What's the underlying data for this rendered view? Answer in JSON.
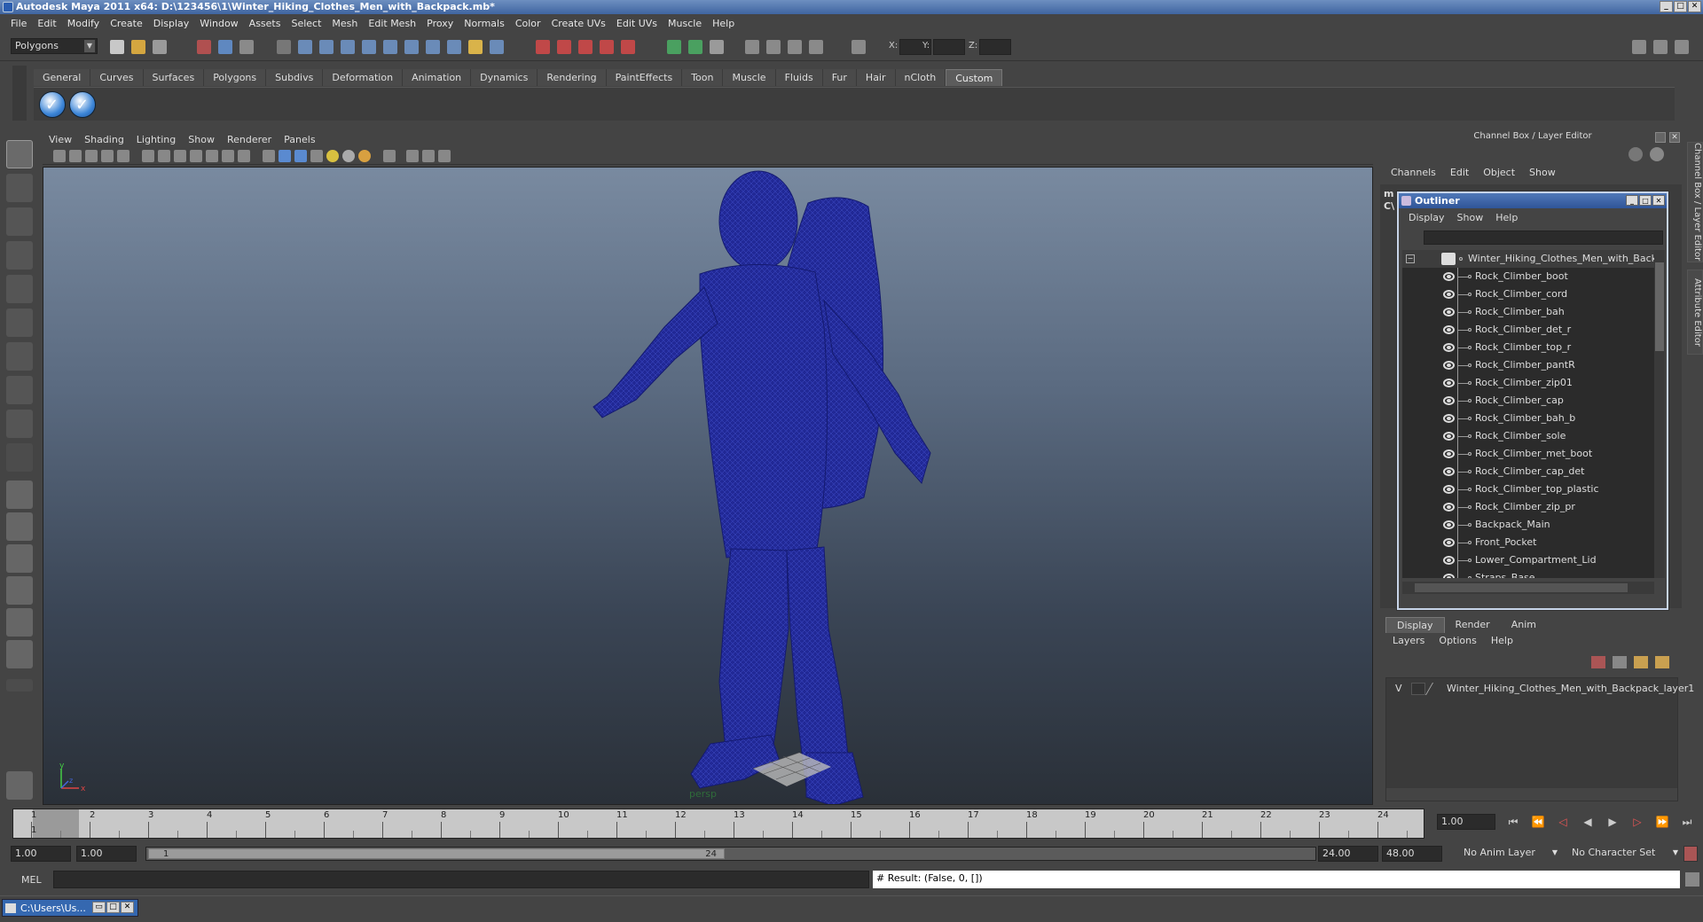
{
  "window": {
    "title": "Autodesk Maya 2011 x64: D:\\123456\\1\\Winter_Hiking_Clothes_Men_with_Backpack.mb*"
  },
  "menubar": [
    "File",
    "Edit",
    "Modify",
    "Create",
    "Display",
    "Window",
    "Assets",
    "Select",
    "Mesh",
    "Edit Mesh",
    "Proxy",
    "Normals",
    "Color",
    "Create UVs",
    "Edit UVs",
    "Muscle",
    "Help"
  ],
  "status": {
    "mode_select": "Polygons",
    "x_label": "X:",
    "y_label": "Y:",
    "z_label": "Z:"
  },
  "shelf": {
    "tabs": [
      "General",
      "Curves",
      "Surfaces",
      "Polygons",
      "Subdivs",
      "Deformation",
      "Animation",
      "Dynamics",
      "Rendering",
      "PaintEffects",
      "Toon",
      "Muscle",
      "Fluids",
      "Fur",
      "Hair",
      "nCloth",
      "Custom"
    ],
    "active": "Custom"
  },
  "viewport": {
    "menu": [
      "View",
      "Shading",
      "Lighting",
      "Show",
      "Renderer",
      "Panels"
    ],
    "camera_label": "persp",
    "axis_x": "x",
    "axis_y": "y",
    "axis_z": "z"
  },
  "channel_box": {
    "header": "Channel Box / Layer Editor",
    "menu": [
      "Channels",
      "Edit",
      "Object",
      "Show"
    ],
    "partial_label_1": "m",
    "partial_label_2": "C\\"
  },
  "outliner": {
    "title": "Outliner",
    "menu": [
      "Display",
      "Show",
      "Help"
    ],
    "root": "Winter_Hiking_Clothes_Men_with_Backpack",
    "items": [
      "Rock_Climber_boot",
      "Rock_Climber_cord",
      "Rock_Climber_bah",
      "Rock_Climber_det_r",
      "Rock_Climber_top_r",
      "Rock_Climber_pantR",
      "Rock_Climber_zip01",
      "Rock_Climber_cap",
      "Rock_Climber_bah_b",
      "Rock_Climber_sole",
      "Rock_Climber_met_boot",
      "Rock_Climber_cap_det",
      "Rock_Climber_top_plastic",
      "Rock_Climber_zip_pr",
      "Backpack_Main",
      "Front_Pocket",
      "Lower_Compartment_Lid",
      "Straps_Base"
    ]
  },
  "layer_editor": {
    "tabs": [
      "Display",
      "Render",
      "Anim"
    ],
    "active": "Display",
    "menu": [
      "Layers",
      "Options",
      "Help"
    ],
    "layer_visibility": "V",
    "layer_name": "Winter_Hiking_Clothes_Men_with_Backpack_layer1"
  },
  "timeline": {
    "ticks": [
      "1",
      "2",
      "3",
      "4",
      "5",
      "6",
      "7",
      "8",
      "9",
      "10",
      "11",
      "12",
      "13",
      "14",
      "15",
      "16",
      "17",
      "18",
      "19",
      "20",
      "21",
      "22",
      "23",
      "24"
    ],
    "current_marker": "1",
    "current_frame": "1.00"
  },
  "range": {
    "start": "1.00",
    "playback_start": "1.00",
    "slider_start": "1",
    "slider_end": "24",
    "playback_end": "24.00",
    "end": "48.00",
    "anim_layer": "No Anim Layer",
    "character_set": "No Character Set"
  },
  "command": {
    "mel_label": "MEL",
    "result": "# Result: (False, 0, [])"
  },
  "taskbar": {
    "task_label": "C:\\Users\\Us..."
  },
  "side_tabs": {
    "channel": "Channel Box / Layer Editor",
    "attribute": "Attribute Editor"
  }
}
